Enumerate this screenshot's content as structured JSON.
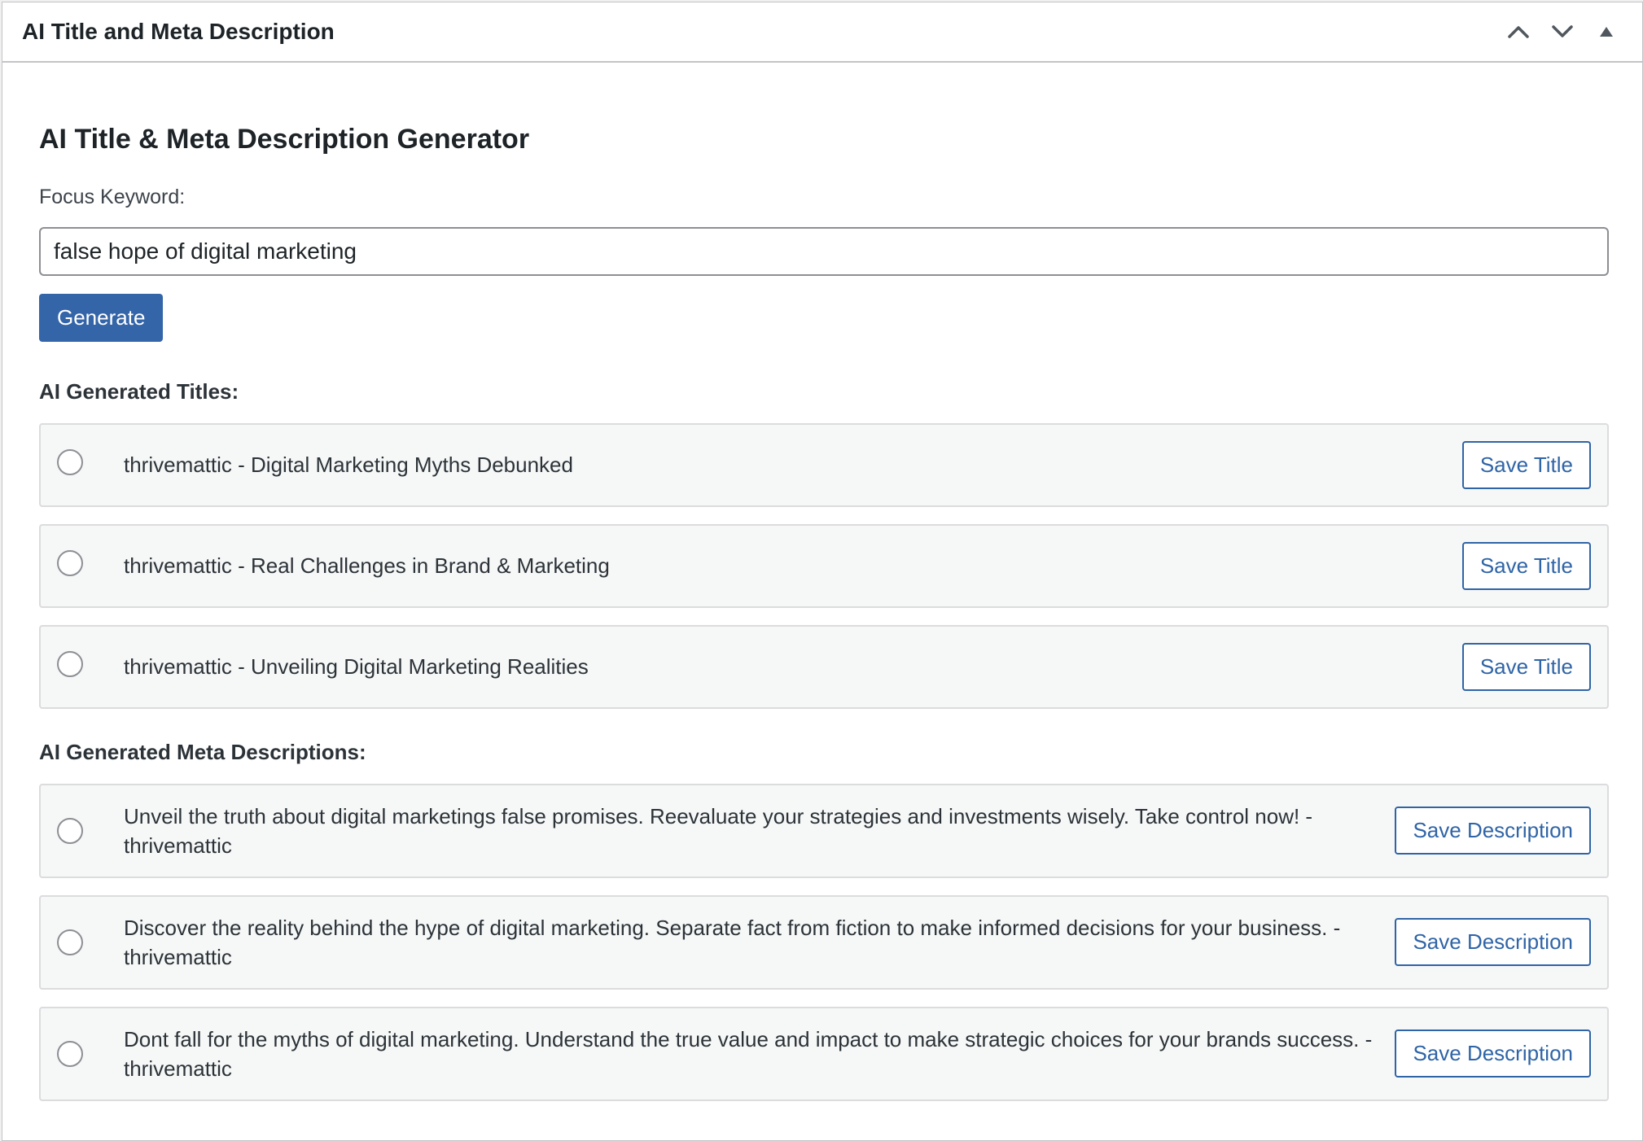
{
  "metabox": {
    "title": "AI Title and Meta Description",
    "controls": {
      "move_up_icon": "chevron-up-icon",
      "move_down_icon": "chevron-down-icon",
      "toggle_icon": "triangle-up-icon"
    }
  },
  "generator": {
    "heading": "AI Title & Meta Description Generator",
    "focus_label": "Focus Keyword:",
    "focus_value": "false hope of digital marketing",
    "generate_label": "Generate"
  },
  "titles": {
    "heading": "AI Generated Titles:",
    "items": [
      {
        "text": "thrivemattic - Digital Marketing Myths Debunked",
        "button": "Save Title"
      },
      {
        "text": "thrivemattic - Real Challenges in Brand & Marketing",
        "button": "Save Title"
      },
      {
        "text": "thrivemattic - Unveiling Digital Marketing Realities",
        "button": "Save Title"
      }
    ]
  },
  "descriptions": {
    "heading": "AI Generated Meta Descriptions:",
    "items": [
      {
        "text": "Unveil the truth about digital marketings false promises. Reevaluate your strategies and investments wisely. Take control now! - thrivemattic",
        "button": "Save Description"
      },
      {
        "text": "Discover the reality behind the hype of digital marketing. Separate fact from fiction to make informed decisions for your business. - thrivemattic",
        "button": "Save Description"
      },
      {
        "text": "Dont fall for the myths of digital marketing. Understand the true value and impact to make strategic choices for your brands success. - thrivemattic",
        "button": "Save Description"
      }
    ]
  },
  "colors": {
    "primary_button": "#3465a8",
    "link_blue": "#2f64a6",
    "row_background": "#f6f7f7",
    "border": "#c3c4c7"
  }
}
